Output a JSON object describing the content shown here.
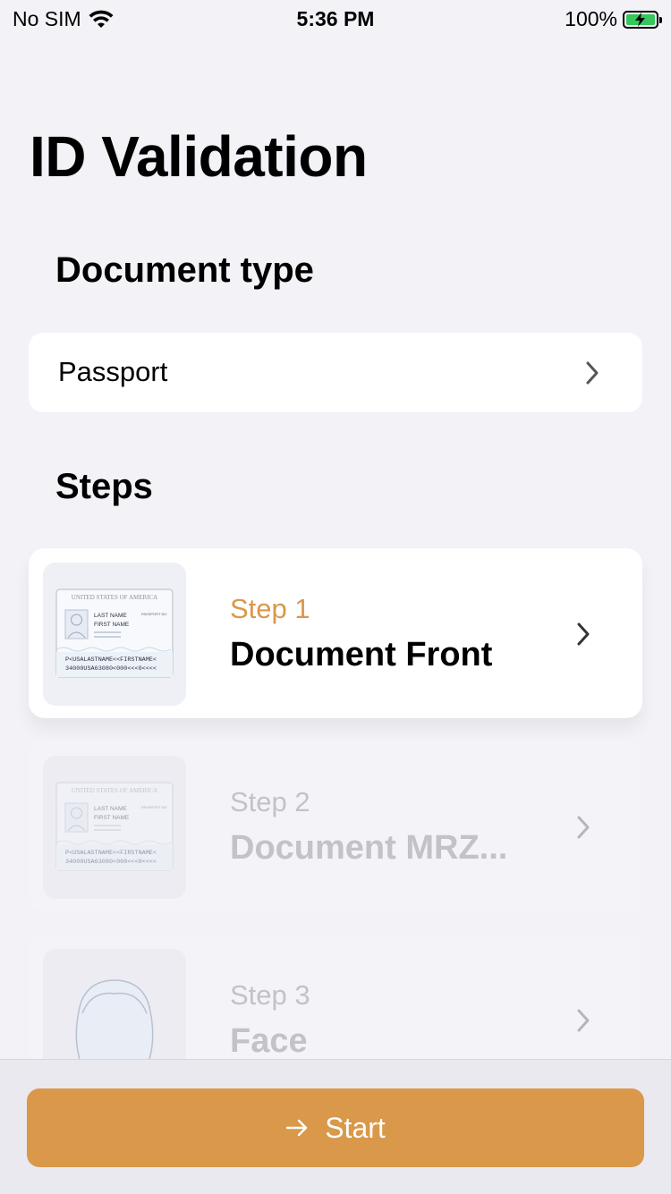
{
  "status_bar": {
    "carrier": "No SIM",
    "time": "5:36 PM",
    "battery_percent": "100%",
    "battery_level": 1.0
  },
  "title": "ID Validation",
  "document_type": {
    "label": "Document type",
    "value": "Passport"
  },
  "steps": {
    "label": "Steps",
    "items": [
      {
        "number": "Step 1",
        "name": "Document Front",
        "state": "active",
        "thumbnail": "passport-card-icon",
        "card": {
          "country": "UNITED STATES OF AMERICA",
          "passport": "PASSPORT NO",
          "last_name": "LAST NAME",
          "first_name": "FIRST NAME",
          "mrz1": "P<USALASTNAME<<FIRSTNAME<",
          "mrz2": "34000USA63080<000<<<0<<<<"
        }
      },
      {
        "number": "Step 2",
        "name": "Document MRZ...",
        "state": "inactive",
        "thumbnail": "passport-card-icon",
        "card": {
          "country": "UNITED STATES OF AMERICA",
          "passport": "PASSPORT NO",
          "last_name": "LAST NAME",
          "first_name": "FIRST NAME",
          "mrz1": "P<USALASTNAME<<FIRSTNAME<",
          "mrz2": "34000USA63080<000<<<0<<<<"
        }
      },
      {
        "number": "Step 3",
        "name": "Face",
        "state": "inactive",
        "thumbnail": "face-outline-icon"
      }
    ]
  },
  "start_button": {
    "label": "Start",
    "icon": "arrow-right-icon"
  },
  "colors": {
    "accent": "#d9984a",
    "background": "#f2f2f7",
    "battery": "#34c759"
  }
}
